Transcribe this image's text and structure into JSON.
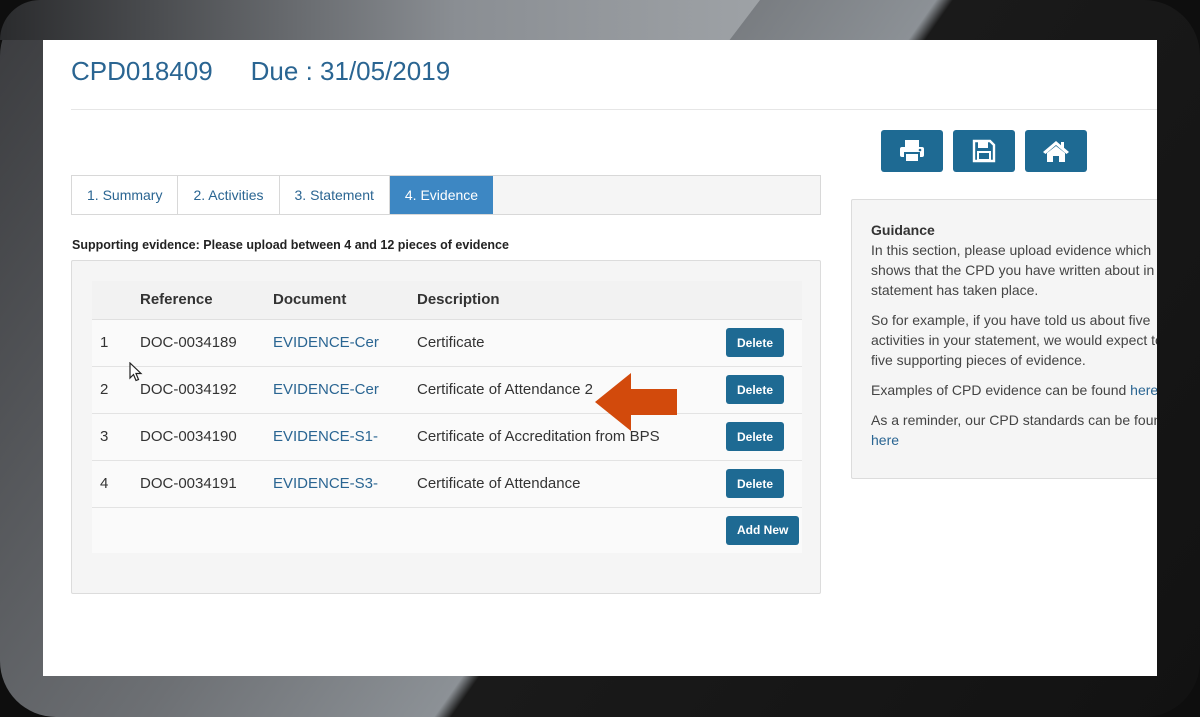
{
  "header": {
    "reference": "CPD018409",
    "due": "Due : 31/05/2019"
  },
  "toolbar": {
    "icons": [
      "print-icon",
      "save-icon",
      "home-icon"
    ]
  },
  "tabs": [
    {
      "label": "1. Summary",
      "active": false
    },
    {
      "label": "2. Activities",
      "active": false
    },
    {
      "label": "3. Statement",
      "active": false
    },
    {
      "label": "4. Evidence",
      "active": true
    }
  ],
  "evidence": {
    "note": "Supporting evidence: Please upload between 4 and 12 pieces of evidence",
    "columns": [
      "Reference",
      "Document",
      "Description"
    ],
    "rows": [
      {
        "num": "1",
        "reference": "DOC-0034189",
        "document": "EVIDENCE-Cer",
        "description": "Certificate",
        "action": "Delete"
      },
      {
        "num": "2",
        "reference": "DOC-0034192",
        "document": "EVIDENCE-Cer",
        "description": "Certificate of Attendance 2",
        "action": "Delete"
      },
      {
        "num": "3",
        "reference": "DOC-0034190",
        "document": "EVIDENCE-S1-",
        "description": "Certificate of Accreditation from BPS",
        "action": "Delete"
      },
      {
        "num": "4",
        "reference": "DOC-0034191",
        "document": "EVIDENCE-S3-",
        "description": "Certificate of Attendance",
        "action": "Delete"
      }
    ],
    "add_label": "Add New"
  },
  "guidance": {
    "title": "Guidance",
    "line1": "In this section, please upload evidence which",
    "line2": "shows that the CPD you have written about in",
    "line3": "statement has taken place.",
    "p2_line1": "So for example, if you have told us about five",
    "p2_line2": "activities in your statement, we would expect to",
    "p2_line3": "five supporting pieces of evidence.",
    "p3_text": "Examples of CPD evidence can be found ",
    "p3_link": "here",
    "p4_text": "As a reminder, our CPD standards can be foun",
    "p4_link": "here"
  },
  "colors": {
    "brand_blue": "#1e6a93",
    "active_tab": "#3d87c3",
    "link": "#2a6592",
    "arrow": "#d24a0c"
  }
}
